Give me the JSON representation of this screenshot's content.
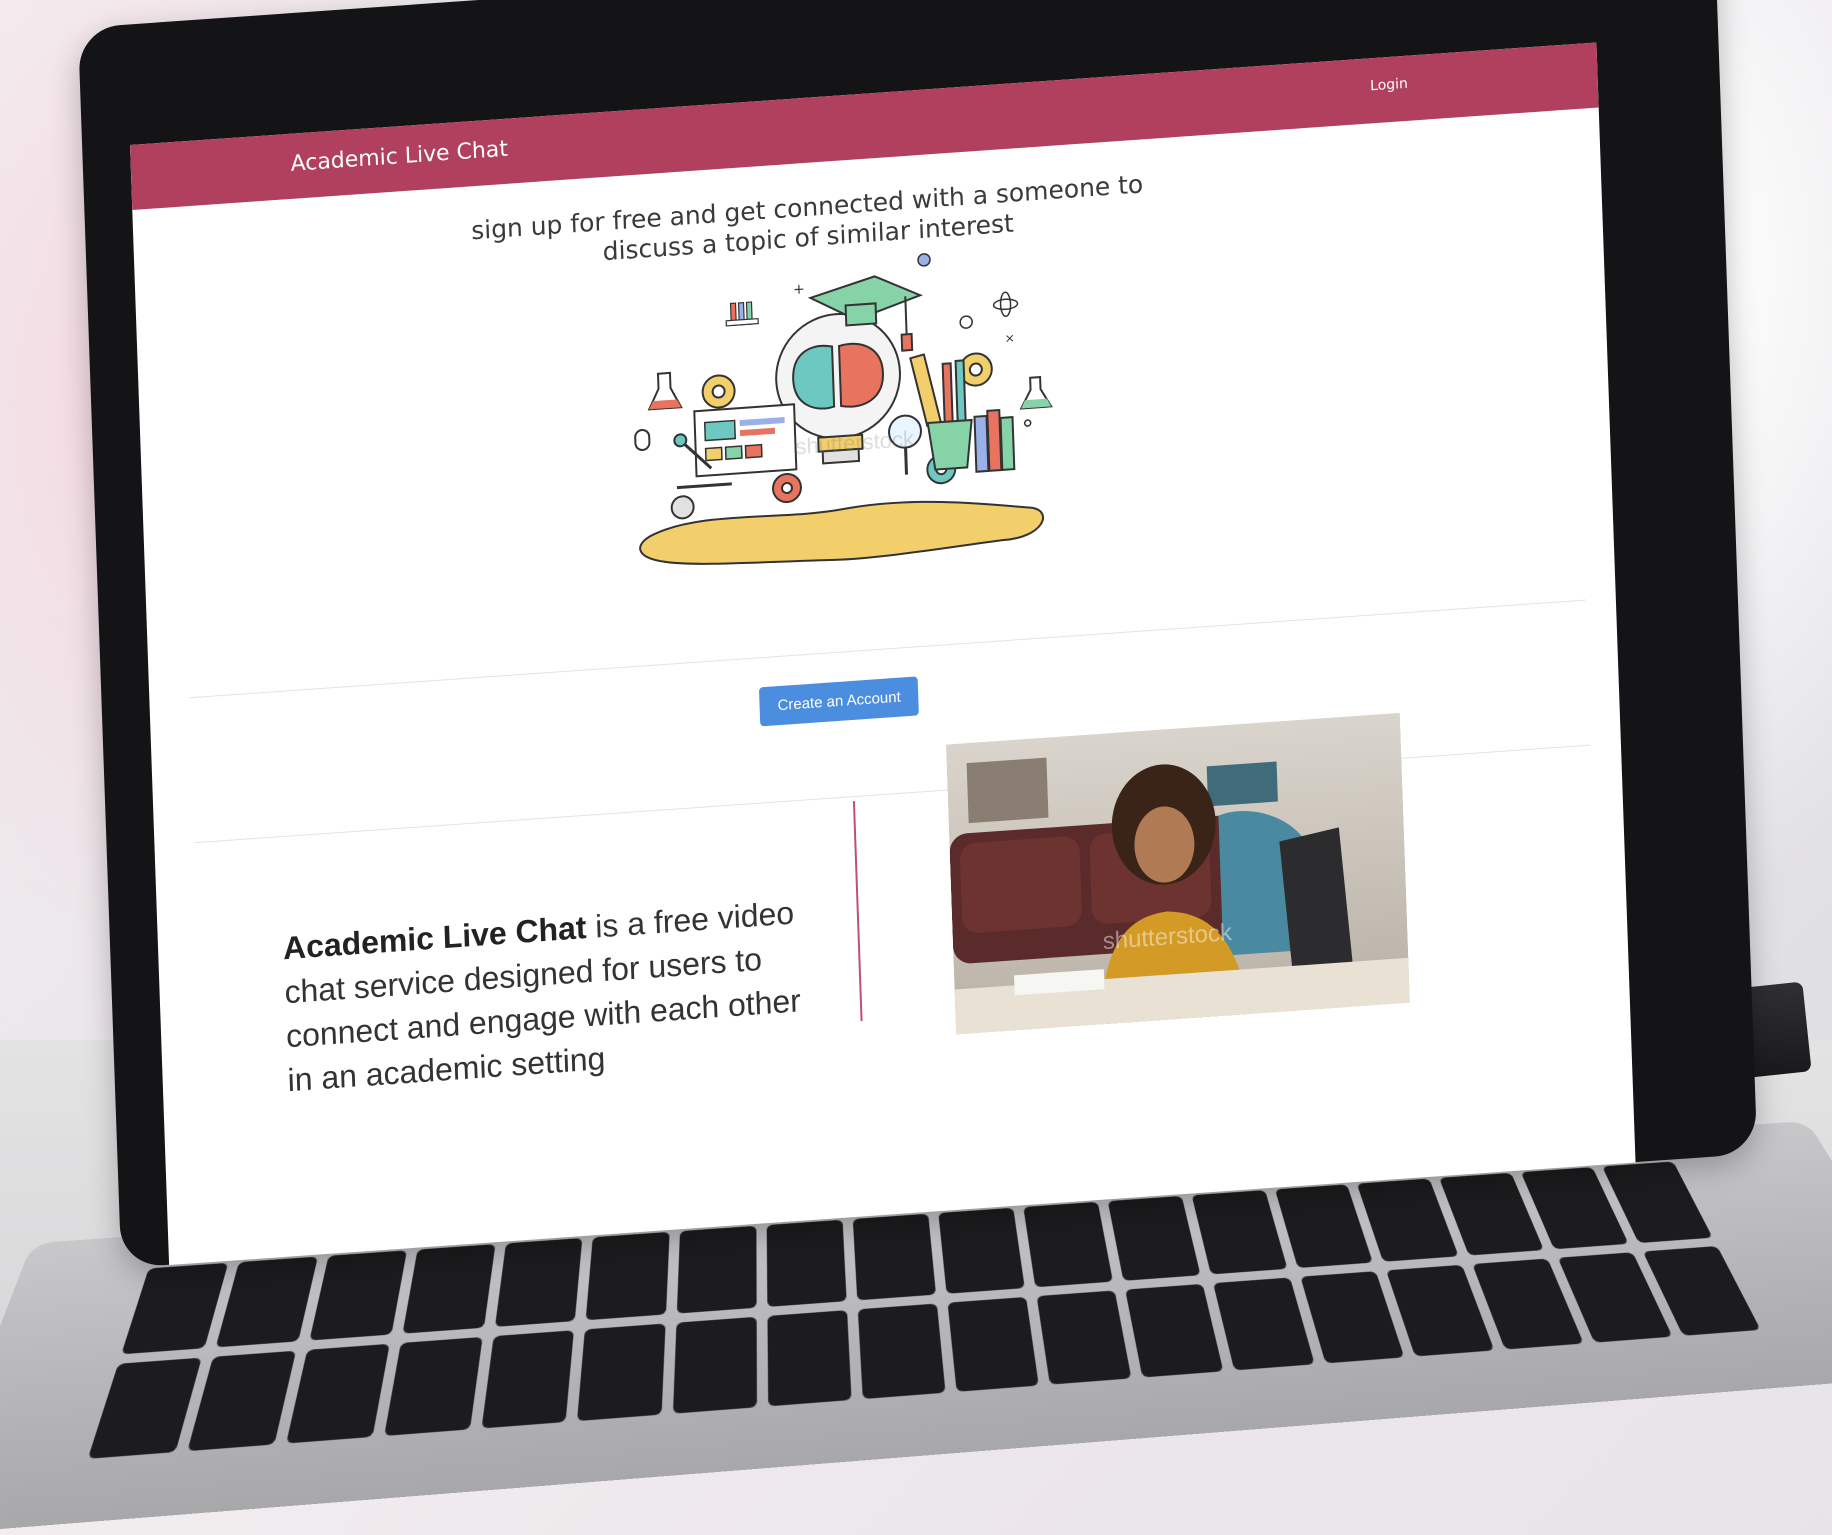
{
  "navbar": {
    "brand": "Academic Live Chat",
    "login_label": "Login",
    "color": "#b1405f"
  },
  "hero": {
    "headline": "sign up for free and get connected with a someone to discuss a topic of similar interest",
    "illustration_icon": "education-brain-lightbulb-illustration",
    "cta_label": "Create an Account",
    "cta_color": "#4b8ee0"
  },
  "about": {
    "brand_bold": "Academic Live Chat",
    "description": " is a free video chat service designed for users to connect and engage with each other in an academic setting",
    "photo_icon": "student-video-chat-photo",
    "accent": "#c0506e"
  },
  "watermarks": {
    "illustration": "shutterstock",
    "photo": "shutterstock"
  }
}
